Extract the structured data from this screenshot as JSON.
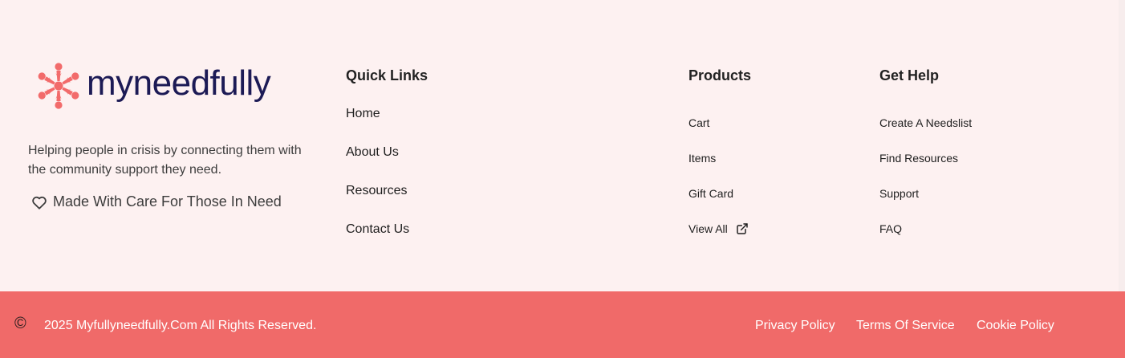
{
  "brand": {
    "name": "myneedfully",
    "logo_color": "#f26b6b",
    "wordmark_color": "#1c1a55"
  },
  "tagline": "Helping people in crisis by connecting them with the community support they need.",
  "made_with_care": {
    "icon": "heart-icon",
    "label": "Made With Care For Those In Need"
  },
  "quick_links": {
    "title": "Quick Links",
    "items": [
      {
        "label": "Home"
      },
      {
        "label": "About Us"
      },
      {
        "label": "Resources"
      },
      {
        "label": "Contact Us"
      }
    ]
  },
  "products": {
    "title": "Products",
    "items": [
      {
        "label": "Cart"
      },
      {
        "label": "Items"
      },
      {
        "label": "Gift Card"
      },
      {
        "label": "View All",
        "icon": "external-link-icon"
      }
    ]
  },
  "get_help": {
    "title": "Get Help",
    "items": [
      {
        "label": "Create A Needslist"
      },
      {
        "label": "Find Resources"
      },
      {
        "label": "Support"
      },
      {
        "label": "FAQ"
      }
    ]
  },
  "bottom_bar": {
    "background": "#f06a69",
    "copyright_symbol": "©",
    "copyright_text": "2025 Myfullyneedfully.Com All Rights Reserved.",
    "links": [
      {
        "label": "Privacy Policy"
      },
      {
        "label": "Terms Of Service"
      },
      {
        "label": "Cookie Policy"
      }
    ]
  }
}
